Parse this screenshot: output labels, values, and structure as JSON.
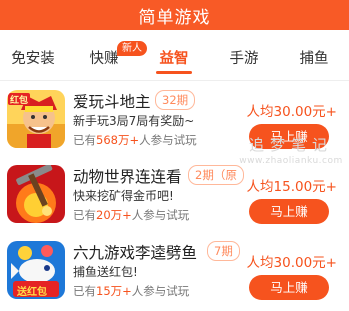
{
  "header": {
    "title": "简单游戏"
  },
  "tabs": [
    {
      "label": "免安装"
    },
    {
      "label": "快赚",
      "badge": "新人"
    },
    {
      "label": "益智",
      "active": true
    },
    {
      "label": "手游"
    },
    {
      "label": "捕鱼"
    }
  ],
  "games": [
    {
      "title": "爱玩斗地主",
      "period": "32期",
      "desc": "新手玩3局7局有奖励~",
      "people_prefix": "已有",
      "people_count": "568万+",
      "people_suffix": "人参与试玩",
      "reward_label": "人均",
      "reward_amount": "30.00元+",
      "button": "马上赚",
      "thumb_label": "红包"
    },
    {
      "title": "动物世界连连看",
      "period": "2期（原",
      "desc": "快来挖矿得金币吧!",
      "people_prefix": "已有",
      "people_count": "20万+",
      "people_suffix": "人参与试玩",
      "reward_label": "人均",
      "reward_amount": "15.00元+",
      "button": "马上赚"
    },
    {
      "title": "六九游戏李逵劈鱼",
      "period": "7期",
      "desc": "捕鱼送红包!",
      "people_prefix": "已有",
      "people_count": "15万+",
      "people_suffix": "人参与试玩",
      "reward_label": "人均",
      "reward_amount": "30.00元+",
      "button": "马上赚",
      "thumb_label": "送红包"
    }
  ],
  "watermark": {
    "text": "追梦笔记",
    "url": "www.zhaolianku.com"
  },
  "colors": {
    "brand": "#f85a26",
    "accent": "#f6531e"
  }
}
